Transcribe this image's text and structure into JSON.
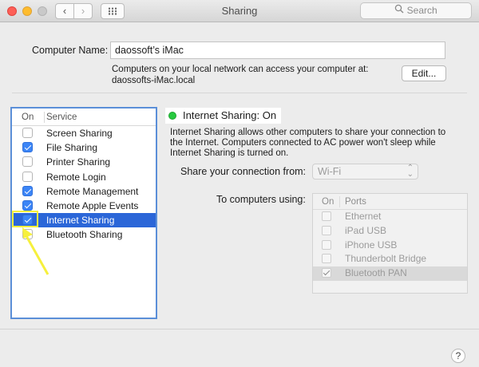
{
  "window": {
    "title": "Sharing"
  },
  "toolbar": {
    "search_placeholder": "Search"
  },
  "computer_name": {
    "label": "Computer Name:",
    "value": "daossoft’s iMac",
    "description_line1": "Computers on your local network can access your computer at:",
    "description_line2": "daossofts-iMac.local",
    "edit_label": "Edit..."
  },
  "services": {
    "header_on": "On",
    "header_service": "Service",
    "items": [
      {
        "label": "Screen Sharing",
        "checked": false
      },
      {
        "label": "File Sharing",
        "checked": true
      },
      {
        "label": "Printer Sharing",
        "checked": false
      },
      {
        "label": "Remote Login",
        "checked": false
      },
      {
        "label": "Remote Management",
        "checked": true
      },
      {
        "label": "Remote Apple Events",
        "checked": true
      },
      {
        "label": "Internet Sharing",
        "checked": true,
        "selected": true
      },
      {
        "label": "Bluetooth Sharing",
        "checked": false
      }
    ]
  },
  "internet_sharing": {
    "status": "Internet Sharing: On",
    "status_color": "#27c93f",
    "description": "Internet Sharing allows other computers to share your connection to the Internet. Computers connected to AC power won't sleep while Internet Sharing is turned on.",
    "share_from_label": "Share your connection from:",
    "share_from_value": "Wi-Fi",
    "to_computers_label": "To computers using:",
    "ports_header_on": "On",
    "ports_header_ports": "Ports",
    "ports": [
      {
        "label": "Ethernet",
        "checked": false
      },
      {
        "label": "iPad USB",
        "checked": false
      },
      {
        "label": "iPhone USB",
        "checked": false
      },
      {
        "label": "Thunderbolt Bridge",
        "checked": false
      },
      {
        "label": "Bluetooth PAN",
        "checked": true,
        "selected": true
      }
    ]
  },
  "help": {
    "label": "?"
  },
  "colors": {
    "selection": "#2b66d8",
    "highlight_annotation": "#f6f03d",
    "list_focus_border": "#5b8fd8"
  }
}
